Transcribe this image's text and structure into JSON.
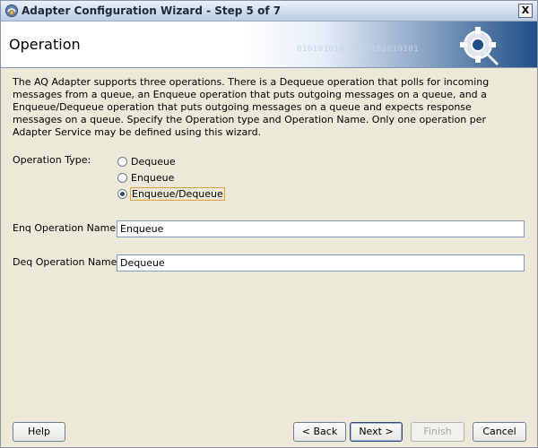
{
  "window": {
    "title": "Adapter Configuration Wizard - Step 5 of 7",
    "close_label": "X"
  },
  "banner": {
    "title": "Operation",
    "decor_binary": "01010101011010101010101"
  },
  "description": "The AQ Adapter supports three operations.  There is a Dequeue operation that polls for incoming messages from a queue, an Enqueue operation that puts outgoing messages on a queue, and a Enqueue/Dequeue operation that puts outgoing messages on a queue and expects response messages on a queue.  Specify the Operation type and Operation Name. Only one operation per Adapter Service may be defined using this wizard.",
  "operation_type": {
    "label": "Operation Type:",
    "options": [
      "Dequeue",
      "Enqueue",
      "Enqueue/Dequeue"
    ],
    "selected": "Enqueue/Dequeue"
  },
  "enq_operation": {
    "label": "Enq Operation Name:",
    "value": "Enqueue"
  },
  "deq_operation": {
    "label": "Deq Operation Name:",
    "value": "Dequeue"
  },
  "buttons": {
    "help": "Help",
    "back": "< Back",
    "next": "Next >",
    "finish": "Finish",
    "cancel": "Cancel"
  },
  "colors": {
    "title_text": "#1e2a3c",
    "selection_outline": "#e2a23b",
    "field_border": "#7f9db9"
  },
  "icons": {
    "app": "adapter-icon",
    "close": "close-icon",
    "banner": "gear-plug-icon"
  }
}
